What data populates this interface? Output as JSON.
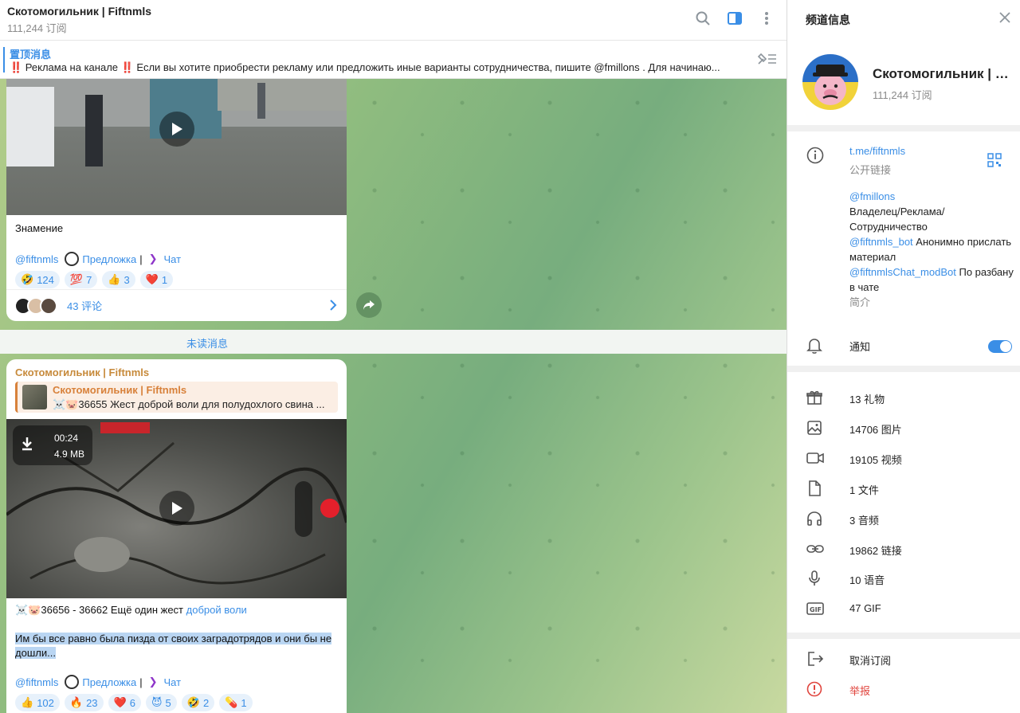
{
  "chat_header": {
    "title": "Скотомогильник | Fiftnmls",
    "subscribers": "111,244 订阅"
  },
  "pinned": {
    "label": "置顶消息",
    "text": "‼️ Реклама на канале ‼️  Если вы хотите приобрести рекламу или предложить иные варианты сотрудничества, пишите @fmillons . Для начинаю..."
  },
  "post1": {
    "caption": "Знамение",
    "signature": {
      "channel": "@fiftnmls",
      "suggest": "Предложка",
      "separator": "|",
      "chat": "Чат"
    },
    "reactions": [
      {
        "emoji": "🤣",
        "count": "124"
      },
      {
        "emoji": "💯",
        "count": "7"
      },
      {
        "emoji": "👍",
        "count": "3"
      },
      {
        "emoji": "❤️",
        "count": "1"
      }
    ],
    "comments": "43 评论"
  },
  "unread_label": "未读消息",
  "post2": {
    "forward_name": "Скотомогильник | Fiftnmls",
    "quote_name": "Скотомогильник | Fiftnmls",
    "quote_text": "☠️🐷36655 Жест доброй воли для полудохлого свина ...",
    "video_time": "00:24",
    "video_size": "4.9 MB",
    "title_prefix": "☠️🐷36656 - 36662 Ещё один жест",
    "title_link": "доброй воли",
    "body": "Им бы все равно была пизда от своих заградотрядов и они бы не дошли...",
    "signature": {
      "channel": "@fiftnmls",
      "suggest": "Предложка",
      "separator": "|",
      "chat": "Чат"
    },
    "reactions": [
      {
        "emoji": "👍",
        "count": "102"
      },
      {
        "emoji": "🔥",
        "count": "23"
      },
      {
        "emoji": "❤️",
        "count": "6"
      },
      {
        "emoji": "😈",
        "count": "5"
      },
      {
        "emoji": "🤣",
        "count": "2"
      },
      {
        "emoji": "💊",
        "count": "1"
      }
    ]
  },
  "panel": {
    "title": "频道信息",
    "channel_name": "Скотомогильник | Fiftnmls",
    "subscribers": "111,244 订阅",
    "link": "t.me/fiftnmls",
    "link_caption": "公开链接",
    "desc_owner_handle": "@fmillons",
    "desc_owner_text": "Владелец/Реклама/Сотрудничество",
    "desc_bot_handle": "@fiftnmls_bot",
    "desc_bot_text": " Анонимно прислать материал",
    "desc_mod_handle": "@fiftnmlsChat_modBot",
    "desc_mod_text": " По разбану в чате",
    "desc_caption": "简介",
    "notifications": "通知",
    "media": [
      {
        "icon": "gift-icon",
        "label": "13 礼物"
      },
      {
        "icon": "image-icon",
        "label": "14706 图片"
      },
      {
        "icon": "video-icon",
        "label": "19105 视频"
      },
      {
        "icon": "file-icon",
        "label": "1 文件"
      },
      {
        "icon": "audio-icon",
        "label": "3 音频"
      },
      {
        "icon": "link-icon",
        "label": "19862 链接"
      },
      {
        "icon": "mic-icon",
        "label": "10 语音"
      },
      {
        "icon": "gif-icon",
        "label": "47 GIF"
      }
    ],
    "unsubscribe": "取消订阅",
    "report": "举报"
  },
  "colors": {
    "accent": "#3a8ee6",
    "danger": "#e0453e",
    "forward": "#c78a3b"
  }
}
